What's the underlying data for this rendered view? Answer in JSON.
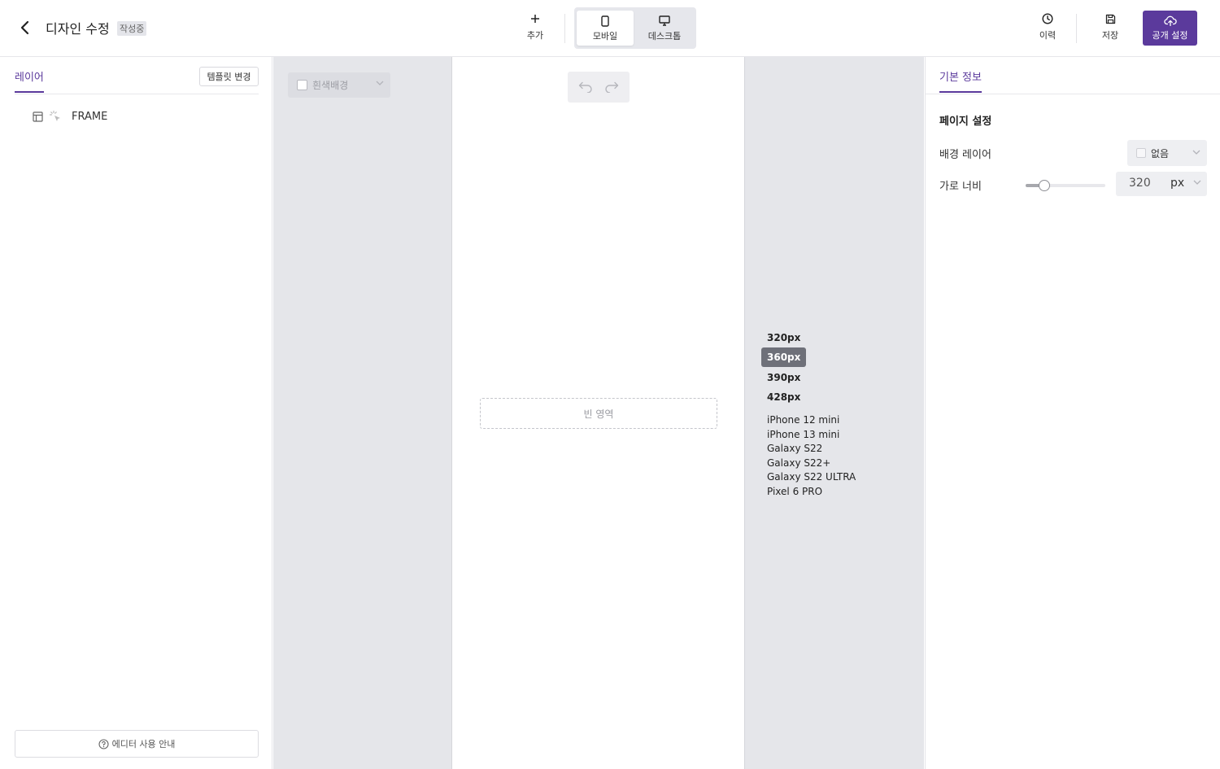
{
  "header": {
    "title": "디자인 수정",
    "status_badge": "작성중",
    "add_label": "추가",
    "view_mobile_label": "모바일",
    "view_desktop_label": "데스크톱",
    "active_view": "mobile",
    "history_label": "이력",
    "save_label": "저장",
    "publish_label": "공개 설정"
  },
  "left_panel": {
    "tab_label": "레이어",
    "template_button": "템플릿 변경",
    "layers": [
      {
        "name": "FRAME",
        "icons": [
          "layout-icon",
          "cursor-click-icon"
        ]
      }
    ],
    "guide_button": "에디터 사용 안내"
  },
  "canvas": {
    "background_select": "흰색배경",
    "empty_area_label": "빈 영역",
    "size_options": [
      "320px",
      "360px",
      "390px",
      "428px"
    ],
    "size_selected_index": 1,
    "devices": [
      "iPhone 12 mini",
      "iPhone 13 mini",
      "Galaxy S22",
      "Galaxy S22+",
      "Galaxy S22 ULTRA",
      "Pixel 6 PRO"
    ]
  },
  "right_panel": {
    "tab_label": "기본 정보",
    "section_title": "페이지 설정",
    "background_layer_label": "배경 레이어",
    "background_layer_value": "없음",
    "width_label": "가로 너비",
    "width_value": "320",
    "width_unit": "px",
    "width_slider_fraction": 0.23
  },
  "colors": {
    "accent": "#5b3a9c",
    "canvas_bg": "#e5e6ea",
    "selected_size_bg": "#6e7079"
  }
}
